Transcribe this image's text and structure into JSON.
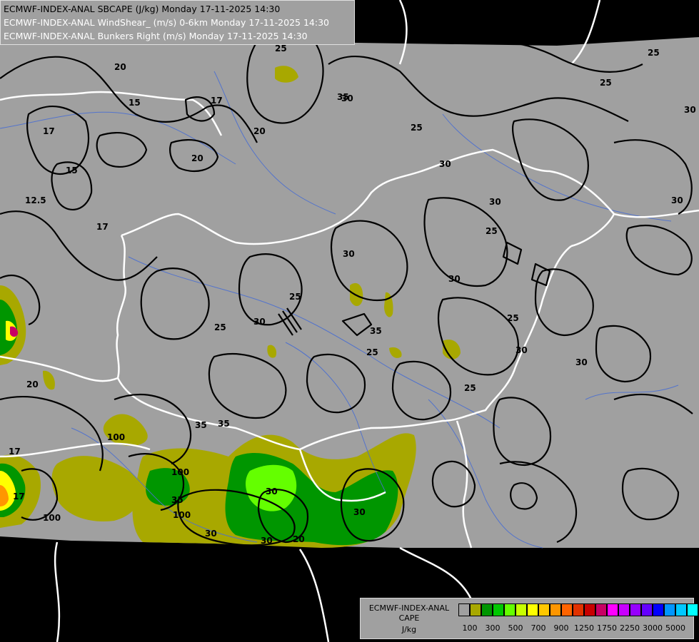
{
  "header": {
    "line1": "ECMWF-INDEX-ANAL SBCAPE (J/kg) Monday 17-11-2025 14:30",
    "line2": "ECMWF-INDEX-ANAL WindShear_ (m/s) 0-6km Monday 17-11-2025 14:30",
    "line3": "ECMWF-INDEX-ANAL Bunkers Right (m/s) Monday 17-11-2025 14:30"
  },
  "legend": {
    "caption1": "ECMWF-INDEX-ANAL",
    "caption2": "CAPE",
    "caption3": "J/kg",
    "colors": [
      "#a0a0a0",
      "#a8a800",
      "#009600",
      "#00c800",
      "#64ff00",
      "#c8ff00",
      "#ffff00",
      "#ffc800",
      "#ff9600",
      "#ff6400",
      "#e13200",
      "#c80000",
      "#c80064",
      "#ff00ff",
      "#c800ff",
      "#9600ff",
      "#6400ff",
      "#0000ff",
      "#0096ff",
      "#00c8ff",
      "#00ffff",
      "#ffffff"
    ],
    "tick_labels": [
      "100",
      "300",
      "500",
      "700",
      "900",
      "1250",
      "1750",
      "2250",
      "3000",
      "5000"
    ]
  },
  "contour_labels": [
    "25",
    "25",
    "20",
    "17",
    "15",
    "17",
    "20",
    "20",
    "15",
    "17",
    "12.5",
    "30",
    "35",
    "25",
    "25",
    "30",
    "30",
    "30",
    "30",
    "25",
    "30",
    "35",
    "30",
    "25",
    "30",
    "25",
    "25",
    "30",
    "30",
    "25",
    "25",
    "30",
    "30",
    "30",
    "35",
    "35",
    "35",
    "30",
    "20",
    "100",
    "100",
    "100",
    "100",
    "17",
    "20",
    "17"
  ]
}
